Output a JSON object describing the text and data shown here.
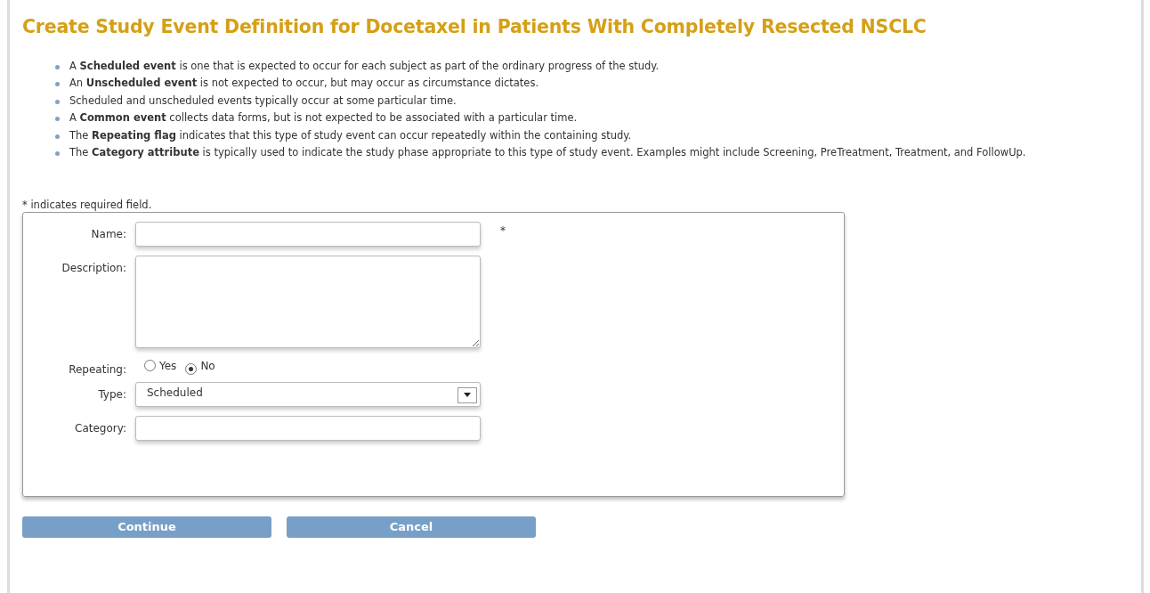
{
  "title": "Create Study Event Definition for Docetaxel in Patients With Completely Resected NSCLC",
  "notes": [
    "A **Scheduled event** is one that is expected to occur for each subject as part of the ordinary progress of the study.",
    "An **Unscheduled event** is not expected to occur, but may occur as circumstance dictates.",
    "Scheduled and unscheduled events typically occur at some particular time.",
    "A **Common event** collects data forms, but is not expected to be associated with a particular time.",
    "The **Repeating flag** indicates that this type of study event can occur repeatedly within the containing study.",
    "The **Category attribute** is typically used to indicate the study phase appropriate to this type of study event. Examples might include Screening, PreTreatment, Treatment, and FollowUp."
  ],
  "required_note": "* indicates required field.",
  "fields": [
    {
      "kind": "text",
      "label": "Name:",
      "required_mark": "*"
    },
    {
      "kind": "textarea",
      "label": "Description:"
    },
    {
      "kind": "radio",
      "label": "Repeating:",
      "options": [
        {
          "label": "Yes",
          "selected": false
        },
        {
          "label": "No",
          "selected": true
        }
      ]
    },
    {
      "kind": "select",
      "label": "Type:",
      "value": "Scheduled"
    },
    {
      "kind": "text",
      "label": "Category:"
    }
  ],
  "buttons": [
    "Continue",
    "Cancel"
  ]
}
